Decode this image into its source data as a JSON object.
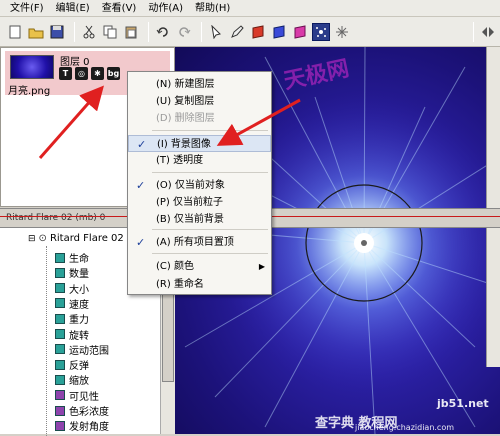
{
  "menubar": {
    "items": [
      "文件(F)",
      "编辑(E)",
      "查看(V)",
      "动作(A)",
      "帮助(H)"
    ]
  },
  "toolbar": {
    "icons": [
      "new-icon",
      "open-icon",
      "save-icon",
      "cut-icon",
      "copy-icon",
      "paste-icon",
      "undo-icon",
      "redo-icon",
      "pointer-icon",
      "pen-icon",
      "red-shape-icon",
      "blue-shape-icon",
      "pink-shape-icon",
      "particle-icon",
      "spark-icon",
      "nav-icon"
    ]
  },
  "layers": {
    "layer_name": "图层 0",
    "file_name": "月亮.png",
    "icon_labels": [
      "T",
      "◎",
      "✱",
      "bg"
    ]
  },
  "panel_header": {
    "title": "Ritard Flare 02 (mb) 0"
  },
  "tree": {
    "root": "Ritard Flare 02 (",
    "items": [
      {
        "label": "生命",
        "color": "#2aa198"
      },
      {
        "label": "数量",
        "color": "#2aa198"
      },
      {
        "label": "大小",
        "color": "#2aa198"
      },
      {
        "label": "速度",
        "color": "#2aa198"
      },
      {
        "label": "重力",
        "color": "#2aa198"
      },
      {
        "label": "旋转",
        "color": "#2aa198"
      },
      {
        "label": "运动范围",
        "color": "#2aa198"
      },
      {
        "label": "反弹",
        "color": "#2aa198"
      },
      {
        "label": "缩放",
        "color": "#2aa198"
      },
      {
        "label": "可见性",
        "color": "#8e44ad"
      },
      {
        "label": "色彩浓度",
        "color": "#8e44ad"
      },
      {
        "label": "发射角度",
        "color": "#8e44ad"
      }
    ]
  },
  "context_menu": {
    "items": [
      {
        "label": "(N) 新建图层",
        "checked": false,
        "disabled": false
      },
      {
        "label": "(U) 复制图层",
        "checked": false,
        "disabled": false
      },
      {
        "label": "(D) 删除图层",
        "checked": false,
        "disabled": true
      },
      {
        "label": "(I) 背景图像",
        "checked": true,
        "disabled": false
      },
      {
        "label": "(T) 透明度",
        "checked": false,
        "disabled": false
      },
      {
        "label": "(O) 仅当前对象",
        "checked": true,
        "disabled": false
      },
      {
        "label": "(P) 仅当前粒子",
        "checked": false,
        "disabled": false
      },
      {
        "label": "(B) 仅当前背景",
        "checked": false,
        "disabled": false
      },
      {
        "label": "(A) 所有项目置顶",
        "checked": true,
        "disabled": false
      },
      {
        "label": "(C) 颜色",
        "checked": false,
        "disabled": false,
        "submenu": true
      },
      {
        "label": "(R) 重命名",
        "checked": false,
        "disabled": false
      }
    ]
  },
  "watermarks": {
    "center": "天极网",
    "bottom": "查字典 教程网",
    "site": "jb51.net",
    "url": "jiaocheng.chazidian.com"
  },
  "colors": {
    "accent_red": "#e02020",
    "highlight": "#dce6f4",
    "layer_selected": "#f2c9cc"
  }
}
